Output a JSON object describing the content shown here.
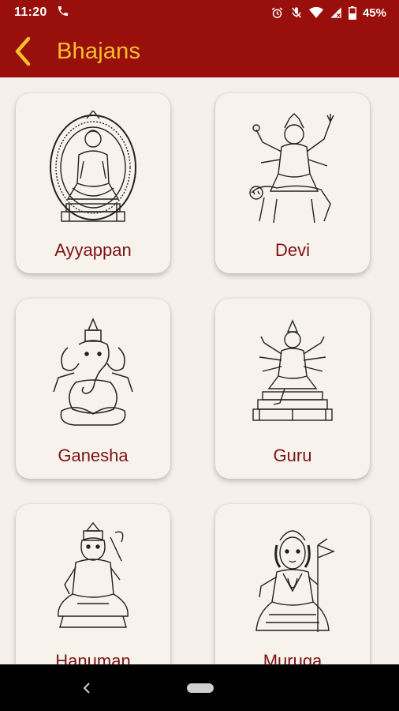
{
  "status_bar": {
    "time": "11:20",
    "battery_percent": "45%",
    "icons": [
      "phone-icon",
      "alarm-icon",
      "mute-icon",
      "wifi-icon",
      "signal-icon",
      "battery-icon"
    ]
  },
  "app_bar": {
    "title": "Bhajans",
    "back_icon": "chevron-left-icon",
    "background_color": "#980f0c",
    "title_color": "#f6c02d"
  },
  "grid": {
    "cards": [
      {
        "label": "Ayyappan",
        "image": "ayyappan-illustration"
      },
      {
        "label": "Devi",
        "image": "devi-illustration"
      },
      {
        "label": "Ganesha",
        "image": "ganesha-illustration"
      },
      {
        "label": "Guru",
        "image": "guru-illustration"
      },
      {
        "label": "Hanuman",
        "image": "hanuman-illustration"
      },
      {
        "label": "Muruga",
        "image": "muruga-illustration"
      }
    ],
    "label_color": "#7d1414"
  },
  "nav_bar": {
    "icons": [
      "nav-back-icon",
      "nav-home-pill"
    ]
  }
}
